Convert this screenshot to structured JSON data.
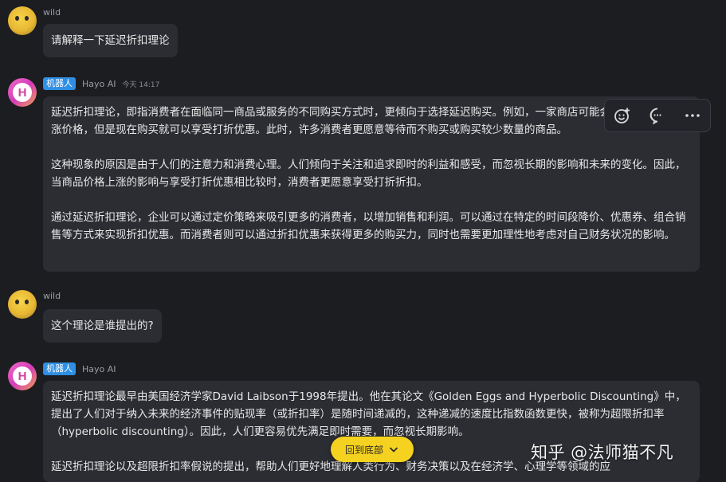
{
  "messages": [
    {
      "sender": "wild",
      "text": "请解释一下延迟折扣理论"
    },
    {
      "badge": "机器人",
      "sender": "Hayo AI",
      "time": "今天 14:17",
      "avatar_letter": "H",
      "paragraphs": [
        "延迟折扣理论，即指消费者在面临同一商品或服务的不同购买方式时，更倾向于选择延迟购买。例如，一家商店可能会在某个时间会上涨价格，但是现在购买就可以享受打折优惠。此时，许多消费者更愿意等待而不购买或购买较少数量的商品。",
        "这种现象的原因是由于人们的注意力和消费心理。人们倾向于关注和追求即时的利益和感受，而忽视长期的影响和未来的变化。因此，当商品价格上涨的影响与享受打折优惠相比较时，消费者更愿意享受打折折扣。",
        "通过延迟折扣理论，企业可以通过定价策略来吸引更多的消费者，以增加销售和利润。可以通过在特定的时间段降价、优惠券、组合销售等方式来实现折扣优惠。而消费者则可以通过折扣优惠来获得更多的购买力，同时也需要更加理性地考虑对自己财务状况的影响。"
      ]
    },
    {
      "sender": "wild",
      "text": "这个理论是谁提出的?"
    },
    {
      "badge": "机器人",
      "sender": "Hayo AI",
      "avatar_letter": "H",
      "paragraphs": [
        "延迟折扣理论最早由美国经济学家David Laibson于1998年提出。他在其论文《Golden Eggs and Hyperbolic Discounting》中，提出了人们对于纳入未来的经济事件的贴现率（或折扣率）是随时间递减的，这种递减的速度比指数函数更快，被称为超限折扣率（hyperbolic discounting）。因此，人们更容易优先满足即时需要，而忽视长期影响。",
        "延迟折扣理论以及超限折扣率假说的提出，帮助人们更好地理解人类行为、财务决策以及在经济学、心理学等领域的应"
      ]
    }
  ],
  "toolbar": {
    "icons": [
      "add-emoji-icon",
      "comment-icon",
      "more-icon"
    ]
  },
  "scroll_to_bottom": {
    "label": "回到底部",
    "icon": "chevron-down-icon"
  },
  "watermark": "知乎 @法师猫不凡",
  "colors": {
    "background": "#1c1d21",
    "bubble": "#2b2d33",
    "badge": "#2e8fe3",
    "scroll_button": "#f5d21f"
  }
}
